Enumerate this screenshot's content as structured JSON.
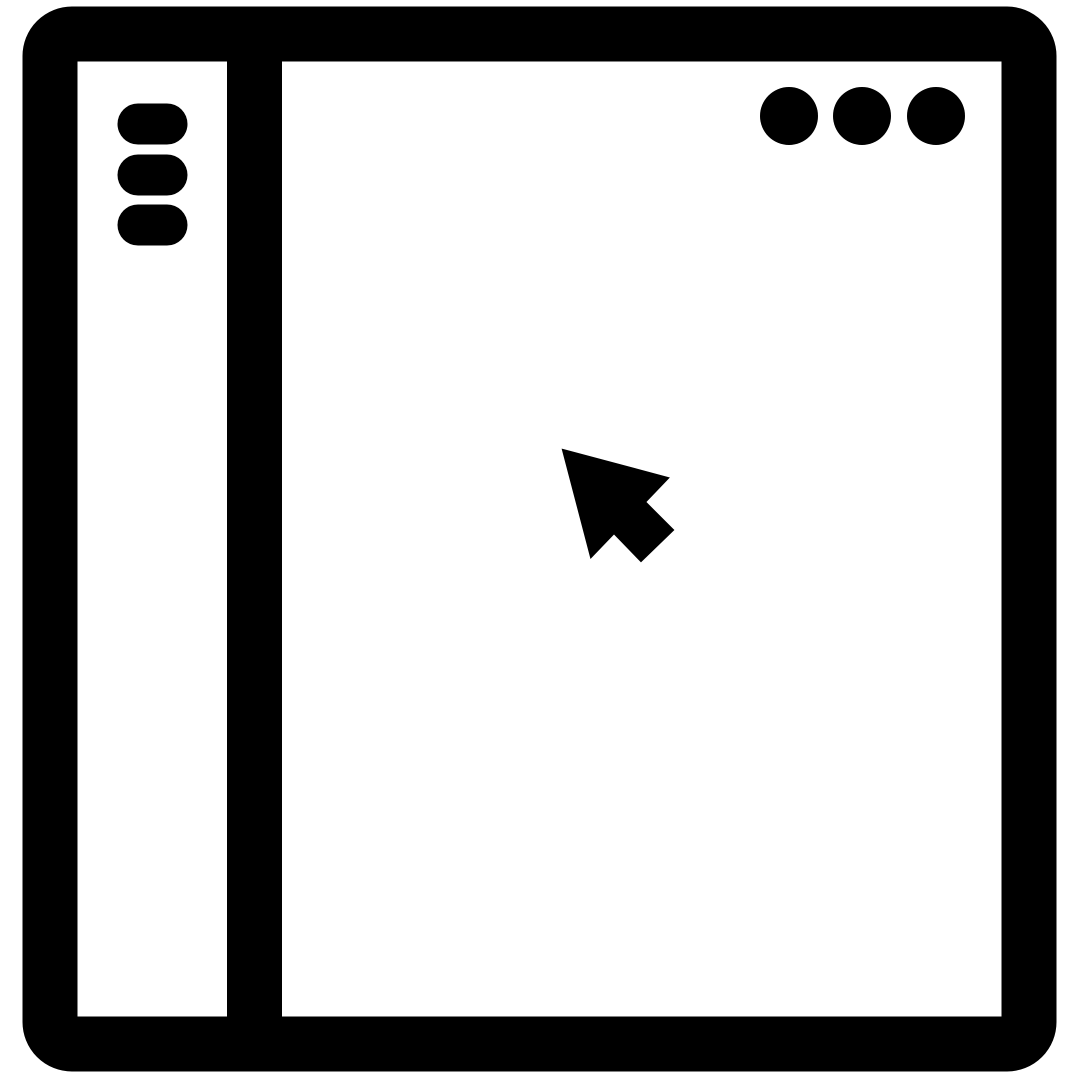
{
  "colors": {
    "stroke": "#000000",
    "fill": "#ffffff"
  },
  "icons": {
    "window": "app-window-icon",
    "sidebar_menu": "hamburger-menu-icon",
    "window_controls": "more-dots-icon",
    "cursor": "mouse-pointer-icon"
  }
}
